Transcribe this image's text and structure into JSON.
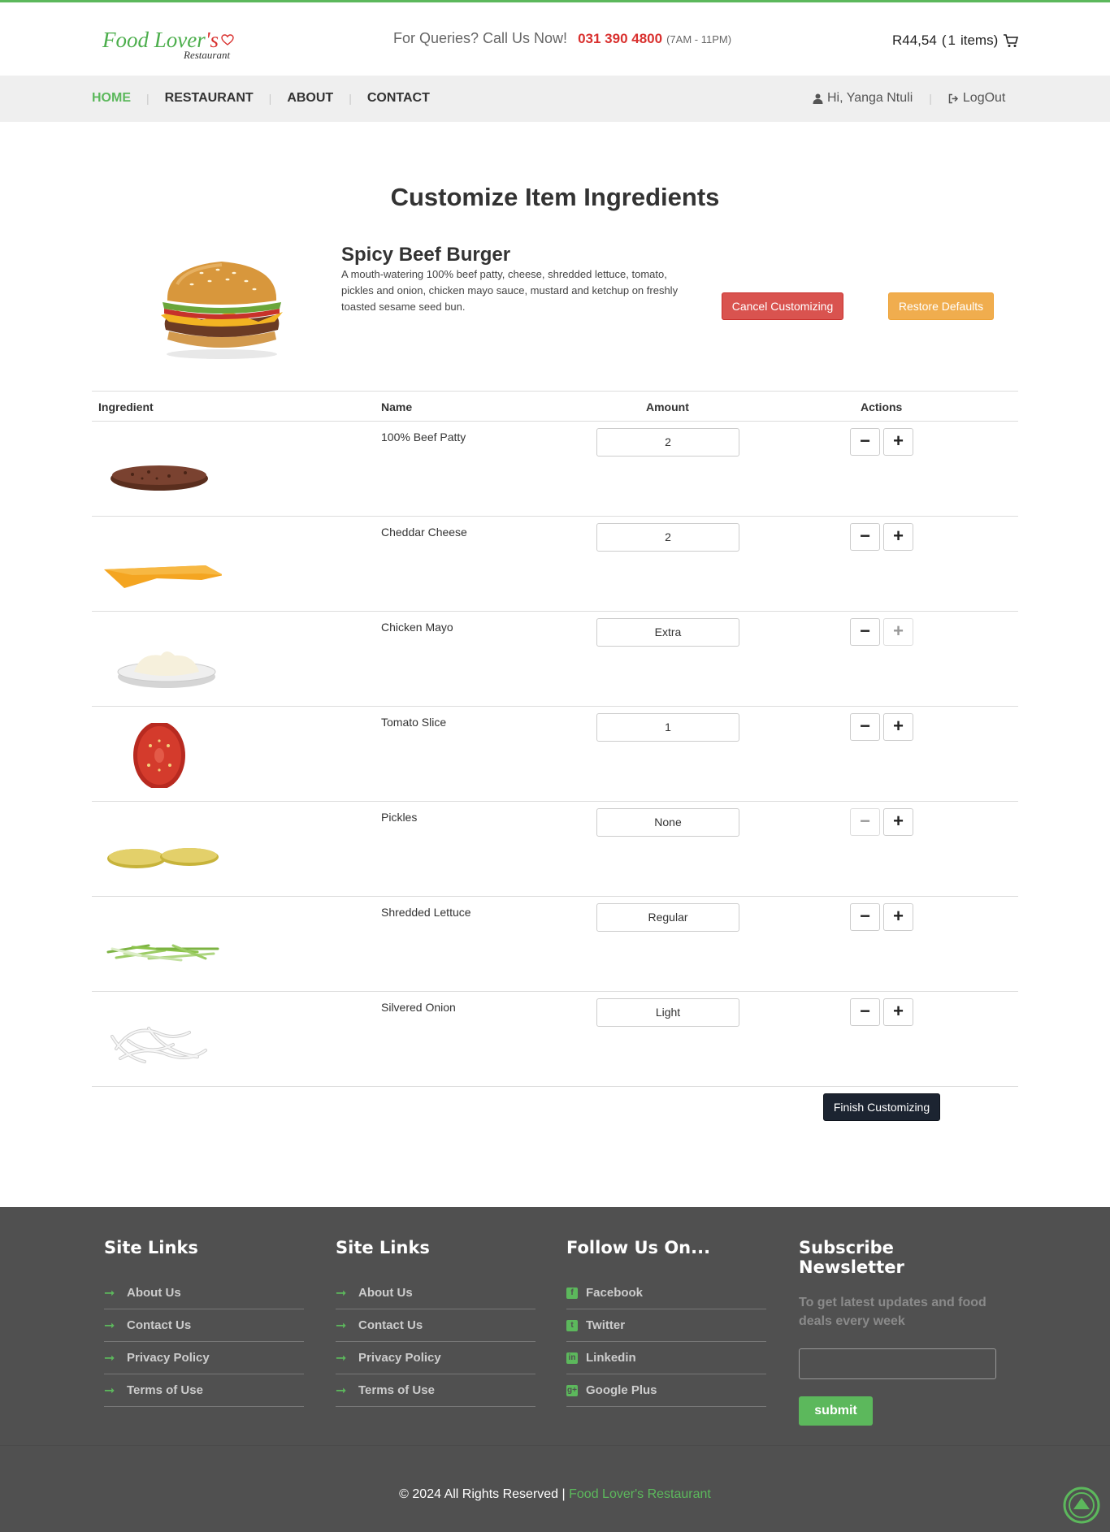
{
  "brand": {
    "logo_main": "Food Lover",
    "logo_apos": "'s",
    "logo_sub": "Restaurant",
    "accent_color": "#5cb85c",
    "logo_red": "#d9302e"
  },
  "header": {
    "queries_label": "For Queries? Call Us Now!",
    "phone": "031 390 4800",
    "hours": "(7AM - 11PM)",
    "cart_total": "R44,54",
    "cart_open": "(",
    "cart_count": "1",
    "cart_items_label": "items)",
    "cart_icon": "shopping-cart-icon"
  },
  "nav": {
    "items": [
      {
        "label": "HOME",
        "active": true
      },
      {
        "label": "RESTAURANT",
        "active": false
      },
      {
        "label": "ABOUT",
        "active": false
      },
      {
        "label": "CONTACT",
        "active": false
      }
    ],
    "user_greeting": "Hi, Yanga Ntuli",
    "logout": "LogOut"
  },
  "main": {
    "title": "Customize Item Ingredients",
    "item_name": "Spicy Beef Burger",
    "item_description": "A mouth-watering 100% beef patty, cheese, shredded lettuce, tomato, pickles and onion, chicken mayo sauce, mustard and ketchup on freshly toasted sesame seed bun.",
    "cancel_button": "Cancel Customizing",
    "restore_button": "Restore Defaults",
    "finish_button": "Finish Customizing",
    "table": {
      "headers": [
        "Ingredient",
        "Name",
        "Amount",
        "Actions"
      ],
      "rows": [
        {
          "name": "100% Beef Patty",
          "amount": "2",
          "minus_disabled": false,
          "plus_disabled": false
        },
        {
          "name": "Cheddar Cheese",
          "amount": "2",
          "minus_disabled": false,
          "plus_disabled": false
        },
        {
          "name": "Chicken Mayo",
          "amount": "Extra",
          "minus_disabled": false,
          "plus_disabled": true
        },
        {
          "name": "Tomato Slice",
          "amount": "1",
          "minus_disabled": false,
          "plus_disabled": false
        },
        {
          "name": "Pickles",
          "amount": "None",
          "minus_disabled": true,
          "plus_disabled": false
        },
        {
          "name": "Shredded Lettuce",
          "amount": "Regular",
          "minus_disabled": false,
          "plus_disabled": false
        },
        {
          "name": "Silvered Onion",
          "amount": "Light",
          "minus_disabled": false,
          "plus_disabled": false
        }
      ],
      "minus_symbol": "−",
      "plus_symbol": "+"
    }
  },
  "footer": {
    "col1": {
      "title": "Site Links",
      "links": [
        "About Us",
        "Contact Us",
        "Privacy Policy",
        "Terms of Use"
      ]
    },
    "col2": {
      "title": "Site Links",
      "links": [
        "About Us",
        "Contact Us",
        "Privacy Policy",
        "Terms of Use"
      ]
    },
    "col3": {
      "title": "Follow Us On...",
      "links": [
        "Facebook",
        "Twitter",
        "Linkedin",
        "Google Plus"
      ]
    },
    "col4": {
      "title": "Subscribe Newsletter",
      "text": "To get latest updates and food deals every week",
      "submit": "submit"
    },
    "copyright": "© 2024 All Rights Reserved |",
    "copyright_brand": "Food Lover's Restaurant"
  }
}
